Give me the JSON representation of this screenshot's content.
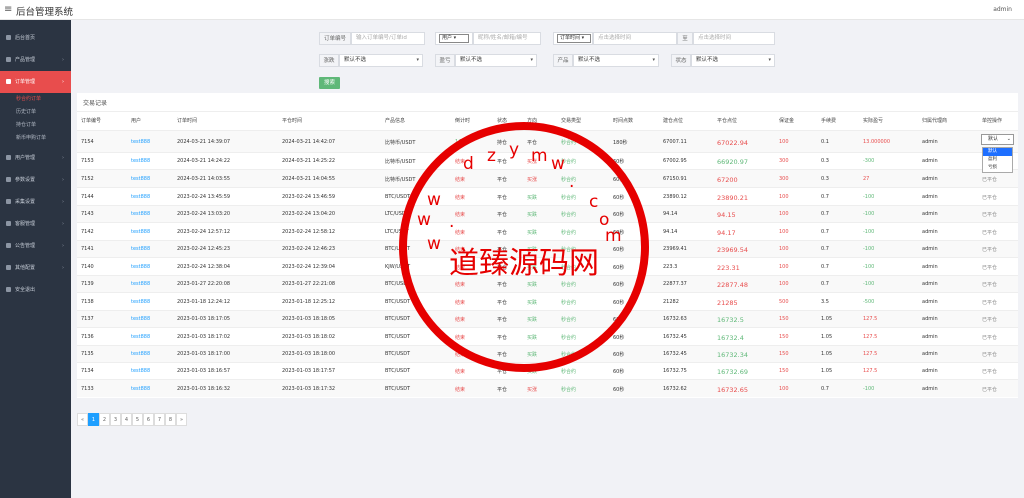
{
  "app": {
    "title": "后台管理系统",
    "user": "admin"
  },
  "sidebar": {
    "items": [
      {
        "label": "后台首页"
      },
      {
        "label": "产品管理"
      },
      {
        "label": "订单管理"
      },
      {
        "label": "用户管理"
      },
      {
        "label": "参数设置"
      },
      {
        "label": "采集设置"
      },
      {
        "label": "客服管理"
      },
      {
        "label": "公告管理"
      },
      {
        "label": "其他配置"
      },
      {
        "label": "安全退出"
      }
    ],
    "sub": [
      "秒合约订单",
      "历史订单",
      "持仓订单",
      "新币申购订单"
    ]
  },
  "filters": {
    "order_label": "订单编号",
    "order_placeholder": "输入订单编号/订单id",
    "user_select": "用户",
    "user_placeholder": "昵称/姓名/邮箱/编号",
    "time_select": "订单时间",
    "time_start_placeholder": "点击选择时间",
    "to": "至",
    "time_end_placeholder": "点击选择时间",
    "direction_label": "涨跌",
    "direction_value": "默认不选",
    "profit_label": "盈亏",
    "profit_value": "默认不选",
    "product_label": "产品",
    "product_value": "默认不选",
    "status_label": "状态",
    "status_value": "默认不选",
    "search_button": "搜索"
  },
  "table": {
    "title": "交易记录",
    "headers": [
      "订单编号",
      "用户",
      "订单时间",
      "平仓时间",
      "产品信息",
      "倒计时",
      "状态",
      "方向",
      "交易类型",
      "时间点数",
      "建仓点位",
      "平仓点位",
      "保证金",
      "手续费",
      "实际盈亏",
      "归属代理商",
      "单控操作"
    ],
    "rows": [
      [
        "7154",
        "test888",
        "2024-03-21 14:39:07",
        "2024-03-21 14:42:07",
        "比特币/USDT",
        "146",
        "持仓",
        "平仓",
        "秒合约",
        "180秒",
        "67007.11",
        "67022.94",
        "100",
        "0.1",
        "13.000000",
        "admin",
        ""
      ],
      [
        "7153",
        "test888",
        "2024-03-21 14:24:22",
        "2024-03-21 14:25:22",
        "比特币/USDT",
        "结束",
        "平仓",
        "买涨",
        "秒合约",
        "60秒",
        "67002.95",
        "66920.97",
        "300",
        "0.3",
        "-300",
        "admin",
        "已平仓"
      ],
      [
        "7152",
        "test888",
        "2024-03-21 14:03:55",
        "2024-03-21 14:04:55",
        "比特币/USDT",
        "结束",
        "平仓",
        "买涨",
        "秒合约",
        "60秒",
        "67150.91",
        "67200",
        "300",
        "0.3",
        "27",
        "admin",
        "已平仓"
      ],
      [
        "7144",
        "test888",
        "2023-02-24 13:45:59",
        "2023-02-24 13:46:59",
        "BTC/USDT",
        "结束",
        "平仓",
        "买跌",
        "秒合约",
        "60秒",
        "23890.12",
        "23890.21",
        "100",
        "0.7",
        "-100",
        "admin",
        "已平仓"
      ],
      [
        "7143",
        "test888",
        "2023-02-24 13:03:20",
        "2023-02-24 13:04:20",
        "LTC/USDT",
        "结束",
        "平仓",
        "买跌",
        "秒合约",
        "60秒",
        "94.14",
        "94.15",
        "100",
        "0.7",
        "-100",
        "admin",
        "已平仓"
      ],
      [
        "7142",
        "test888",
        "2023-02-24 12:57:12",
        "2023-02-24 12:58:12",
        "LTC/USDT",
        "结束",
        "平仓",
        "买跌",
        "秒合约",
        "60秒",
        "94.14",
        "94.17",
        "100",
        "0.7",
        "-100",
        "admin",
        "已平仓"
      ],
      [
        "7141",
        "test888",
        "2023-02-24 12:45:23",
        "2023-02-24 12:46:23",
        "BTC/USDT",
        "结束",
        "平仓",
        "买跌",
        "秒合约",
        "60秒",
        "23969.41",
        "23969.54",
        "100",
        "0.7",
        "-100",
        "admin",
        "已平仓"
      ],
      [
        "7140",
        "test888",
        "2023-02-24 12:38:04",
        "2023-02-24 12:39:04",
        "KJW/USDT",
        "结束",
        "平仓",
        "买跌",
        "秒合约",
        "60秒",
        "223.3",
        "223.31",
        "100",
        "0.7",
        "-100",
        "admin",
        "已平仓"
      ],
      [
        "7139",
        "test888",
        "2023-01-27 22:20:08",
        "2023-01-27 22:21:08",
        "BTC/USDT",
        "结束",
        "平仓",
        "买跌",
        "秒合约",
        "60秒",
        "22877.37",
        "22877.48",
        "100",
        "0.7",
        "-100",
        "admin",
        "已平仓"
      ],
      [
        "7138",
        "test888",
        "2023-01-18 12:24:12",
        "2023-01-18 12:25:12",
        "BTC/USDT",
        "结束",
        "平仓",
        "买跌",
        "秒合约",
        "60秒",
        "21282",
        "21285",
        "500",
        "3.5",
        "-500",
        "admin",
        "已平仓"
      ],
      [
        "7137",
        "test888",
        "2023-01-03 18:17:05",
        "2023-01-03 18:18:05",
        "BTC/USDT",
        "结束",
        "平仓",
        "买跌",
        "秒合约",
        "60秒",
        "16732.63",
        "16732.5",
        "150",
        "1.05",
        "127.5",
        "admin",
        "已平仓"
      ],
      [
        "7136",
        "test888",
        "2023-01-03 18:17:02",
        "2023-01-03 18:18:02",
        "BTC/USDT",
        "结束",
        "平仓",
        "买跌",
        "秒合约",
        "60秒",
        "16732.45",
        "16732.4",
        "150",
        "1.05",
        "127.5",
        "admin",
        "已平仓"
      ],
      [
        "7135",
        "test888",
        "2023-01-03 18:17:00",
        "2023-01-03 18:18:00",
        "BTC/USDT",
        "结束",
        "平仓",
        "买跌",
        "秒合约",
        "60秒",
        "16732.45",
        "16732.34",
        "150",
        "1.05",
        "127.5",
        "admin",
        "已平仓"
      ],
      [
        "7134",
        "test888",
        "2023-01-03 18:16:57",
        "2023-01-03 18:17:57",
        "BTC/USDT",
        "结束",
        "平仓",
        "买跌",
        "秒合约",
        "60秒",
        "16732.75",
        "16732.69",
        "150",
        "1.05",
        "127.5",
        "admin",
        "已平仓"
      ],
      [
        "7133",
        "test888",
        "2023-01-03 18:16:32",
        "2023-01-03 18:17:32",
        "BTC/USDT",
        "结束",
        "平仓",
        "买涨",
        "秒合约",
        "60秒",
        "16732.62",
        "16732.65",
        "100",
        "0.7",
        "-100",
        "admin",
        "已平仓"
      ]
    ],
    "dropdown": {
      "value": "默认",
      "options": [
        "默认",
        "盈利",
        "亏损"
      ]
    }
  },
  "pager": [
    "«",
    "1",
    "2",
    "3",
    "4",
    "5",
    "6",
    "7",
    "8",
    "»"
  ],
  "watermark": {
    "text": "道臻源码网",
    "letters": [
      "w",
      "w",
      "w",
      ".",
      "d",
      "z",
      "y",
      "m",
      "w",
      ".",
      "c",
      "o",
      "m"
    ]
  },
  "colors": {
    "sidebar": "#2b3442",
    "accent_red": "#e84d4d",
    "link_blue": "#1e9fff",
    "green": "#5fb878",
    "stamp": "#e60000"
  }
}
